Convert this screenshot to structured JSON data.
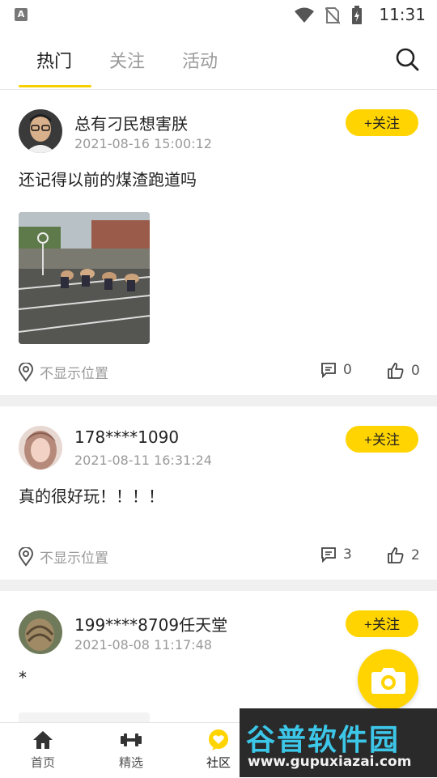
{
  "status_bar": {
    "time": "11:31"
  },
  "tabs": [
    {
      "label": "热门",
      "active": true
    },
    {
      "label": "关注",
      "active": false
    },
    {
      "label": "活动",
      "active": false
    }
  ],
  "posts": [
    {
      "username": "总有刁民想害朕",
      "timestamp": "2021-08-16 15:00:12",
      "follow_label": "+关注",
      "content": "还记得以前的煤渣跑道吗",
      "has_image": true,
      "location": "不显示位置",
      "comments": "0",
      "likes": "0"
    },
    {
      "username": "178****1090",
      "timestamp": "2021-08-11 16:31:24",
      "follow_label": "+关注",
      "content": "真的很好玩！！！！",
      "has_image": false,
      "location": "不显示位置",
      "comments": "3",
      "likes": "2"
    },
    {
      "username": "199****8709任天堂",
      "timestamp": "2021-08-08 11:17:48",
      "follow_label": "+关注",
      "content": "*",
      "has_image": true
    }
  ],
  "bottom_nav": [
    {
      "label": "首页",
      "icon": "home-icon",
      "active": false
    },
    {
      "label": "精选",
      "icon": "dumbbell-icon",
      "active": false
    },
    {
      "label": "社区",
      "icon": "heart-chat-icon",
      "active": true
    }
  ],
  "watermark": {
    "line1": "谷普软件园",
    "line2": "www.gupuxiazai.com"
  },
  "colors": {
    "accent": "#ffd400",
    "text": "#222222",
    "muted": "#9a9a9a",
    "separator": "#f0f0f0"
  }
}
